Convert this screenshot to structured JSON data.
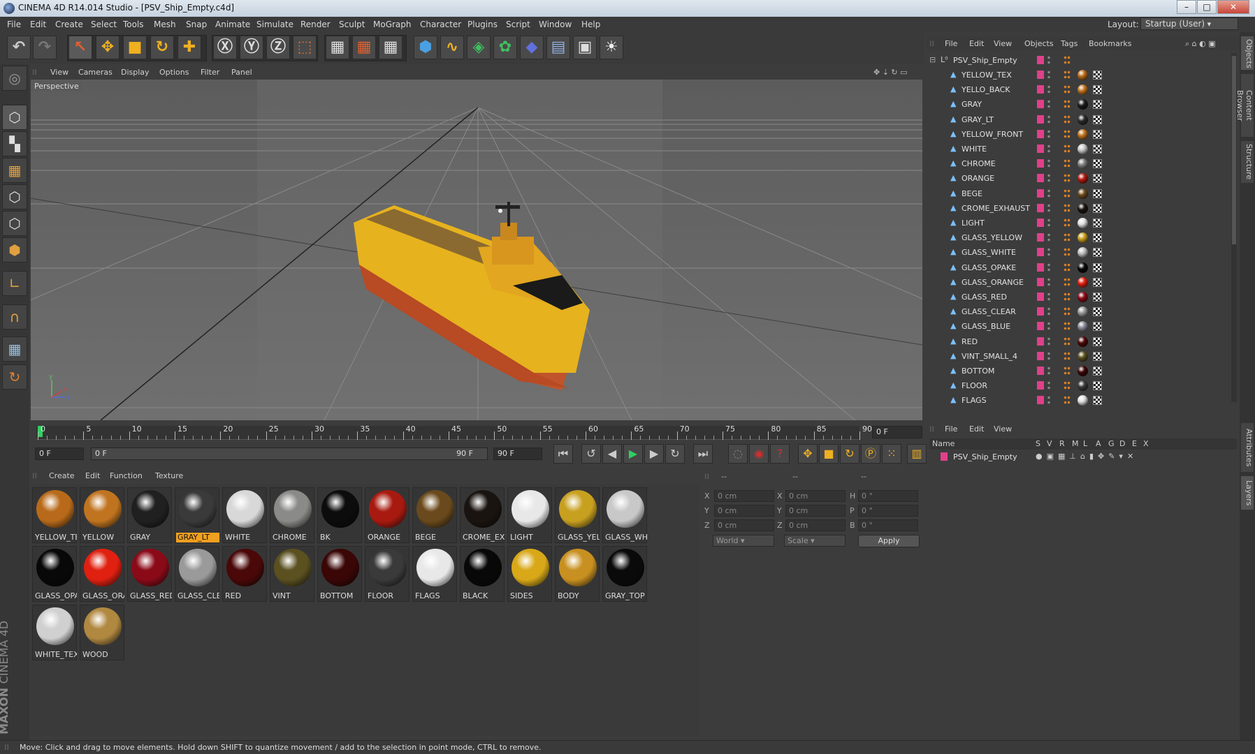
{
  "window": {
    "title": "CINEMA 4D R14.014 Studio - [PSV_Ship_Empty.c4d]",
    "minimize": "–",
    "maximize": "□",
    "close": "✕"
  },
  "menu": [
    "File",
    "Edit",
    "Create",
    "Select",
    "Tools",
    "Mesh",
    "Snap",
    "Animate",
    "Simulate",
    "Render",
    "Sculpt",
    "MoGraph",
    "Character",
    "Plugins",
    "Script",
    "Window",
    "Help"
  ],
  "layout": {
    "label": "Layout:",
    "value": "Startup (User)"
  },
  "viewport": {
    "menu": [
      "View",
      "Cameras",
      "Display",
      "Options",
      "Filter",
      "Panel"
    ],
    "label": "Perspective"
  },
  "timeline": {
    "ticks": [
      "0",
      "5",
      "10",
      "15",
      "20",
      "25",
      "30",
      "35",
      "40",
      "45",
      "50",
      "55",
      "60",
      "65",
      "70",
      "75",
      "80",
      "85",
      "90"
    ],
    "current_frame": "0 F",
    "start_field": "0 F",
    "range_start": "0 F",
    "range_end": "90 F",
    "end_field": "90 F"
  },
  "materials": {
    "menu": [
      "Create",
      "Edit",
      "Function",
      "Texture"
    ],
    "items": [
      {
        "name": "YELLOW_TE",
        "color": "#b86a1a"
      },
      {
        "name": "YELLOW",
        "color": "#c07420"
      },
      {
        "name": "GRAY",
        "color": "#202020"
      },
      {
        "name": "GRAY_LT",
        "color": "#3a3a3a",
        "selected": true
      },
      {
        "name": "WHITE",
        "color": "#d8d8d8"
      },
      {
        "name": "CHROME",
        "color": "#8a8a88"
      },
      {
        "name": "BK",
        "color": "#0c0c0c"
      },
      {
        "name": "ORANGE",
        "color": "#a81a10"
      },
      {
        "name": "BEGE",
        "color": "#6a4a1c"
      },
      {
        "name": "CROME_EX",
        "color": "#1a1410"
      },
      {
        "name": "LIGHT",
        "color": "#e8e8e8"
      },
      {
        "name": "GLASS_YELL",
        "color": "#c8a020"
      },
      {
        "name": "GLASS_WH",
        "color": "#c8c8c8"
      },
      {
        "name": "GLASS_OPA",
        "color": "#080808"
      },
      {
        "name": "GLASS_ORA",
        "color": "#e02010"
      },
      {
        "name": "GLASS_RED",
        "color": "#8a0a18"
      },
      {
        "name": "GLASS_CLE",
        "color": "#9a9a9a"
      },
      {
        "name": "RED",
        "color": "#4a0808"
      },
      {
        "name": "VINT",
        "color": "#5a5020"
      },
      {
        "name": "BOTTOM",
        "color": "#3a0606"
      },
      {
        "name": "FLOOR",
        "color": "#3a3a3a"
      },
      {
        "name": "FLAGS",
        "color": "#e8e8e8"
      },
      {
        "name": "BLACK",
        "color": "#080808"
      },
      {
        "name": "SIDES",
        "color": "#d8a818"
      },
      {
        "name": "BODY",
        "color": "#c89020"
      },
      {
        "name": "GRAY_TOP",
        "color": "#0a0a0a"
      },
      {
        "name": "WHITE_TEX",
        "color": "#d0d0d0"
      },
      {
        "name": "WOOD",
        "color": "#b08840"
      }
    ]
  },
  "coordinates": {
    "headers": [
      "--",
      "--",
      "--"
    ],
    "labels_pos": [
      "X",
      "Y",
      "Z"
    ],
    "labels_size": [
      "X",
      "Y",
      "Z"
    ],
    "labels_rot": [
      "H",
      "P",
      "B"
    ],
    "pos_values": [
      "0 cm",
      "0 cm",
      "0 cm"
    ],
    "size_values": [
      "0 cm",
      "0 cm",
      "0 cm"
    ],
    "rot_values": [
      "0 °",
      "0 °",
      "0 °"
    ],
    "mode": "World",
    "scale": "Scale",
    "apply": "Apply"
  },
  "objects": {
    "menu": [
      "File",
      "Edit",
      "View",
      "Objects",
      "Tags",
      "Bookmarks"
    ],
    "root": "PSV_Ship_Empty",
    "rows": [
      {
        "name": "YELLOW_TEX",
        "tag": "#b86a1a"
      },
      {
        "name": "YELLO_BACK",
        "tag": "#c07420"
      },
      {
        "name": "GRAY",
        "tag": "#1a1a1a"
      },
      {
        "name": "GRAY_LT",
        "tag": "#2a2a2a"
      },
      {
        "name": "YELLOW_FRONT",
        "tag": "#c07420"
      },
      {
        "name": "WHITE",
        "tag": "#c8c8c8"
      },
      {
        "name": "CHROME",
        "tag": "#808080"
      },
      {
        "name": "ORANGE",
        "tag": "#b01a10"
      },
      {
        "name": "BEGE",
        "tag": "#6a4a1c"
      },
      {
        "name": "CROME_EXHAUST",
        "tag": "#1a1410"
      },
      {
        "name": "LIGHT",
        "tag": "#e0e0e0"
      },
      {
        "name": "GLASS_YELLOW",
        "tag": "#c8a020"
      },
      {
        "name": "GLASS_WHITE",
        "tag": "#c0c0c0"
      },
      {
        "name": "GLASS_OPAKE",
        "tag": "#080808"
      },
      {
        "name": "GLASS_ORANGE",
        "tag": "#e02010"
      },
      {
        "name": "GLASS_RED",
        "tag": "#8a0a18"
      },
      {
        "name": "GLASS_CLEAR",
        "tag": "#9a9a9a"
      },
      {
        "name": "GLASS_BLUE",
        "tag": "#8a8a9a"
      },
      {
        "name": "RED",
        "tag": "#4a0808"
      },
      {
        "name": "VINT_SMALL_4",
        "tag": "#5a5020"
      },
      {
        "name": "BOTTOM",
        "tag": "#3a0606"
      },
      {
        "name": "FLOOR",
        "tag": "#3a3a3a"
      },
      {
        "name": "FLAGS",
        "tag": "#e0e0e0"
      }
    ]
  },
  "layers": {
    "menu": [
      "File",
      "Edit",
      "View"
    ],
    "columns": [
      "Name",
      "S",
      "V",
      "R",
      "M",
      "L",
      "A",
      "G",
      "D",
      "E",
      "X"
    ],
    "row": "PSV_Ship_Empty"
  },
  "side_tabs": [
    "Objects",
    "Content Browser",
    "Structure",
    "Attributes",
    "Layers"
  ],
  "brand": {
    "maxon": "MAXON",
    "product": "CINEMA 4D"
  },
  "status": "Move: Click and drag to move elements. Hold down SHIFT to quantize movement / add to the selection in point mode, CTRL to remove."
}
